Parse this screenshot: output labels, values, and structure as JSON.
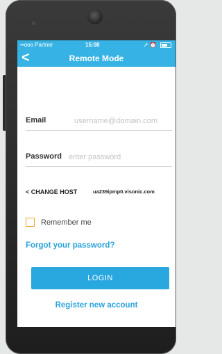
{
  "status_bar": {
    "carrier": "••ooo Partner",
    "time": "15:08"
  },
  "header": {
    "back_glyph": "<",
    "title": "Remote Mode"
  },
  "form": {
    "email_label": "Email",
    "email_placeholder": "username@domain.com",
    "password_label": "Password",
    "password_placeholder": "enter password"
  },
  "host": {
    "button_label": "< CHANGE HOST",
    "value": "ua239ipmp0.visonic.com"
  },
  "remember_label": "Remember me",
  "forgot_link": "Forgot your password?",
  "login_label": "LOGIN",
  "register_link": "Register new account",
  "colors": {
    "accent": "#36b3e4",
    "link": "#2aa3dc",
    "checkbox_border": "#f2a628"
  }
}
